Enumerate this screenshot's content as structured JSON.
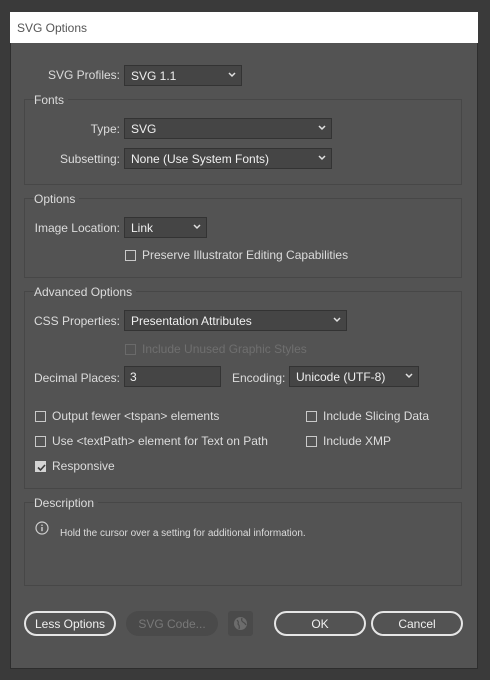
{
  "dialog": {
    "title": "SVG Options"
  },
  "profiles": {
    "label": "SVG Profiles:",
    "value": "SVG 1.1"
  },
  "fonts": {
    "section_title": "Fonts",
    "type_label": "Type:",
    "type_value": "SVG",
    "subsetting_label": "Subsetting:",
    "subsetting_value": "None (Use System Fonts)"
  },
  "options": {
    "section_title": "Options",
    "image_location_label": "Image Location:",
    "image_location_value": "Link",
    "preserve_label": "Preserve Illustrator Editing Capabilities",
    "preserve_checked": false
  },
  "advanced": {
    "section_title": "Advanced Options",
    "css_label": "CSS Properties:",
    "css_value": "Presentation Attributes",
    "unused_styles_label": "Include Unused Graphic Styles",
    "unused_styles_checked": false,
    "decimal_label": "Decimal Places:",
    "decimal_value": "3",
    "encoding_label": "Encoding:",
    "encoding_value": "Unicode (UTF-8)",
    "fewer_tspan_label": "Output fewer <tspan> elements",
    "fewer_tspan_checked": false,
    "textpath_label": "Use <textPath> element for Text on Path",
    "textpath_checked": false,
    "responsive_label": "Responsive",
    "responsive_checked": true,
    "slicing_label": "Include Slicing Data",
    "slicing_checked": false,
    "xmp_label": "Include XMP",
    "xmp_checked": false
  },
  "description": {
    "section_title": "Description",
    "text": "Hold the cursor over a setting for additional information."
  },
  "buttons": {
    "less_options": "Less Options",
    "svg_code": "SVG Code...",
    "ok": "OK",
    "cancel": "Cancel"
  },
  "icons": {
    "dropdown": "chevron-down-icon",
    "info": "info-icon",
    "globe": "globe-icon",
    "check": "checkmark-icon"
  }
}
